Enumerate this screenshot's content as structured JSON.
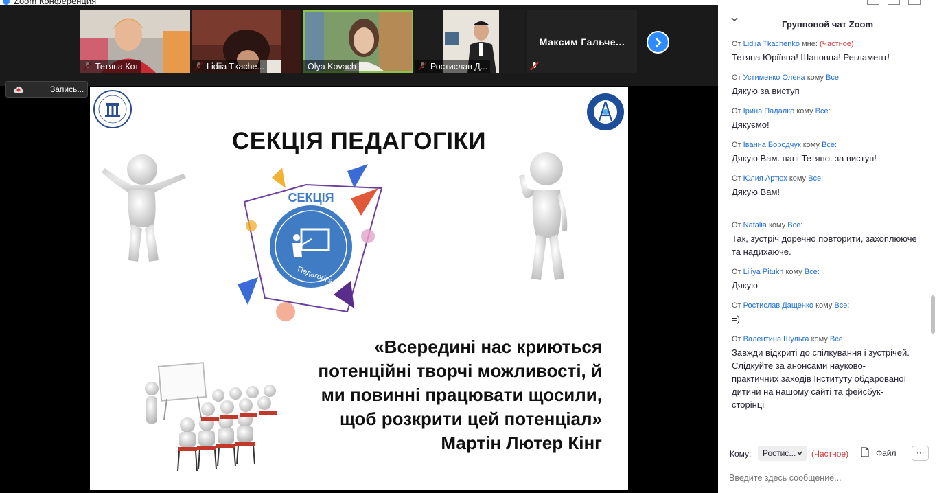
{
  "window": {
    "title": "Zoom Конференция"
  },
  "participants": [
    {
      "name": "Тетяна Кот",
      "muted": true
    },
    {
      "name": "Lidiia Tkache...",
      "muted": true
    },
    {
      "name": "Olya Kovach",
      "muted": false,
      "active": true
    },
    {
      "name": "Ростислав Д...",
      "muted": true
    },
    {
      "name": "Максим  Гальче...",
      "muted": true
    }
  ],
  "recording": {
    "label": "Запись..."
  },
  "slide": {
    "title": "СЕКЦІЯ ПЕДАГОГІКИ",
    "badge_top": "СЕКЦІЯ",
    "badge_bottom": "Педагогіка",
    "quote_lines": [
      "«Всередині нас криються",
      "потенційні творчі можливості, й",
      "ми повинні працювати щосили,",
      "щоб розкрити цей потенціал»"
    ],
    "author": "Мартін Лютер Кінг"
  },
  "chat": {
    "title": "Групповой чат Zoom",
    "messages": [
      {
        "from": "Lidiia Tkachenko",
        "to": "мне:",
        "private": "(Частное)",
        "text": "Тетяна Юріївна! Шановна! Регламент!"
      },
      {
        "from": "Устименко Олена",
        "to": "Все:",
        "text": "Дякую за виступ"
      },
      {
        "from": "Ірина Падалко",
        "to": "Все:",
        "text": "Дякуємо!"
      },
      {
        "from": "Іванна Бородчук",
        "to": "Все:",
        "text": "Дякую Вам. пані Тетяно. за виступ!"
      },
      {
        "from": "Юлия Артюх",
        "to": "Все:",
        "text": "Дякую Вам!"
      },
      {
        "from": "Natalia",
        "to": "Все:",
        "text": "Так, зустріч доречно повторити, захоплююче та надихаюче."
      },
      {
        "from": "Liliya Pitukh",
        "to": "Все:",
        "text": "Дякую"
      },
      {
        "from": "Ростислав Дащенко",
        "to": "Все:",
        "text": "=)"
      },
      {
        "from": "Валентина Шульга",
        "to": "Все:",
        "text": "Завжди відкриті до спілкування і зустрічей. Слідкуйте за анонсами науково-практичних заходів Інституту обдарованої дитини на нашому сайті та фейсбук-сторінці"
      }
    ],
    "from_prefix": "От",
    "to_word": "кому",
    "footer": {
      "to_label": "Кому:",
      "to_value": "Ростис...",
      "private_label": "(Частное)",
      "file_label": "Файл",
      "more_label": "···",
      "placeholder": "Введите здесь сообщение..."
    }
  },
  "colors": {
    "accent": "#2d8cff",
    "chat_name": "#1f6fd6",
    "private": "#d43b3b",
    "active_tile": "#8bc34a"
  }
}
